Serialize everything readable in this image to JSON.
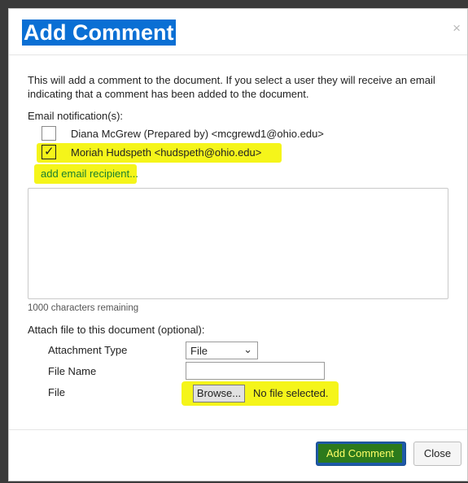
{
  "dialog": {
    "title": "Add Comment",
    "close_glyph": "×"
  },
  "intro": "This will add a comment to the document. If you select a user they will receive an email indicating that a comment has been added to the document.",
  "notifications": {
    "label": "Email notification(s):",
    "recipients": [
      {
        "text": "Diana McGrew (Prepared by) <mcgrewd1@ohio.edu>",
        "checked": false
      },
      {
        "text": "Moriah Hudspeth <hudspeth@ohio.edu>",
        "checked": true
      }
    ],
    "add_link": "add email recipient..."
  },
  "comment": {
    "value": "",
    "remaining": "1000 characters remaining"
  },
  "attach": {
    "label": "Attach file to this document (optional):",
    "type_label": "Attachment Type",
    "type_value": "File",
    "name_label": "File Name",
    "name_value": "",
    "file_label": "File",
    "browse": "Browse...",
    "no_file": "No file selected."
  },
  "buttons": {
    "add": "Add Comment",
    "close": "Close"
  },
  "icons": {
    "close": "close-icon",
    "checkmark": "checkmark-icon",
    "chevron": "chevron-down-icon",
    "resize": "resize-grip-icon"
  },
  "colors": {
    "title_bg": "#0a6fd4",
    "highlight": "#f5f51a",
    "link": "#1a7f2e",
    "primary_button": "#1e5aa8"
  }
}
